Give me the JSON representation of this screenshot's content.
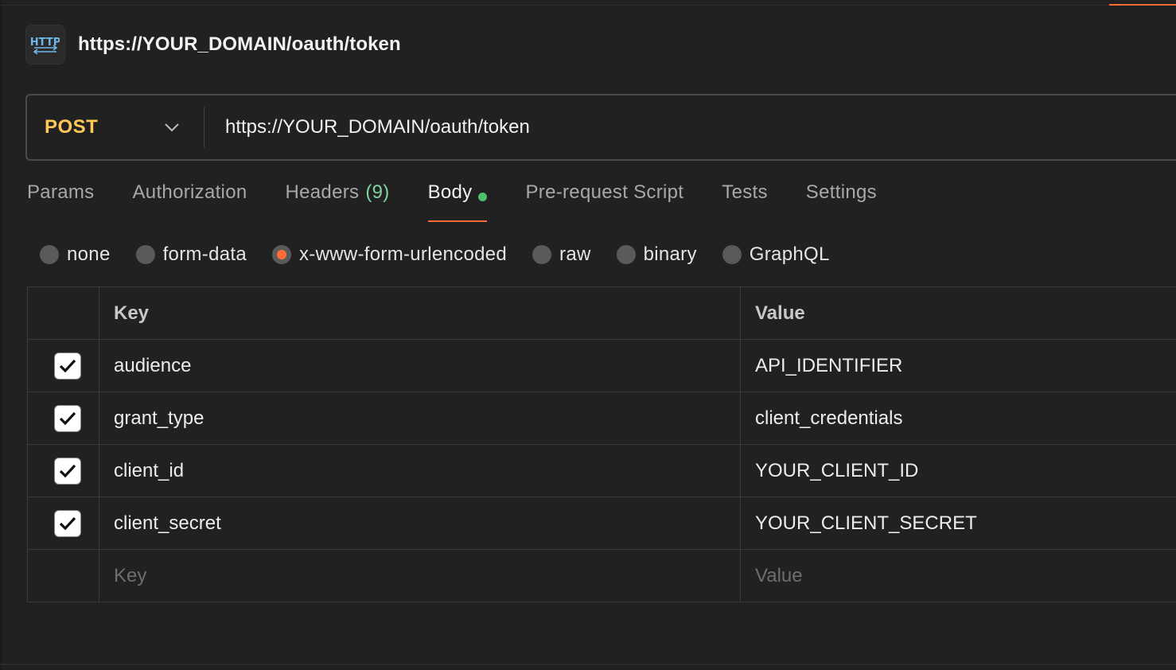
{
  "request": {
    "title": "https://YOUR_DOMAIN/oauth/token",
    "badge_icon": "http-icon",
    "method": "POST",
    "url": "https://YOUR_DOMAIN/oauth/token"
  },
  "tabs": [
    {
      "label": "Params"
    },
    {
      "label": "Authorization"
    },
    {
      "label": "Headers",
      "count": "(9)"
    },
    {
      "label": "Body",
      "active": true
    },
    {
      "label": "Pre-request Script"
    },
    {
      "label": "Tests"
    },
    {
      "label": "Settings"
    }
  ],
  "body_types": [
    {
      "label": "none",
      "selected": false
    },
    {
      "label": "form-data",
      "selected": false
    },
    {
      "label": "x-www-form-urlencoded",
      "selected": true
    },
    {
      "label": "raw",
      "selected": false
    },
    {
      "label": "binary",
      "selected": false
    },
    {
      "label": "GraphQL",
      "selected": false
    }
  ],
  "table": {
    "headers": {
      "key": "Key",
      "value": "Value"
    },
    "rows": [
      {
        "key": "audience",
        "value": "API_IDENTIFIER",
        "checked": true
      },
      {
        "key": "grant_type",
        "value": "client_credentials",
        "checked": true
      },
      {
        "key": "client_id",
        "value": "YOUR_CLIENT_ID",
        "checked": true
      },
      {
        "key": "client_secret",
        "value": "YOUR_CLIENT_SECRET",
        "checked": true
      }
    ],
    "placeholder": {
      "key": "Key",
      "value": "Value"
    }
  },
  "colors": {
    "accent": "#ff6c37",
    "method": "#ffc857",
    "body_dot": "#4cc26a",
    "headers_count": "#7fd3a0"
  }
}
